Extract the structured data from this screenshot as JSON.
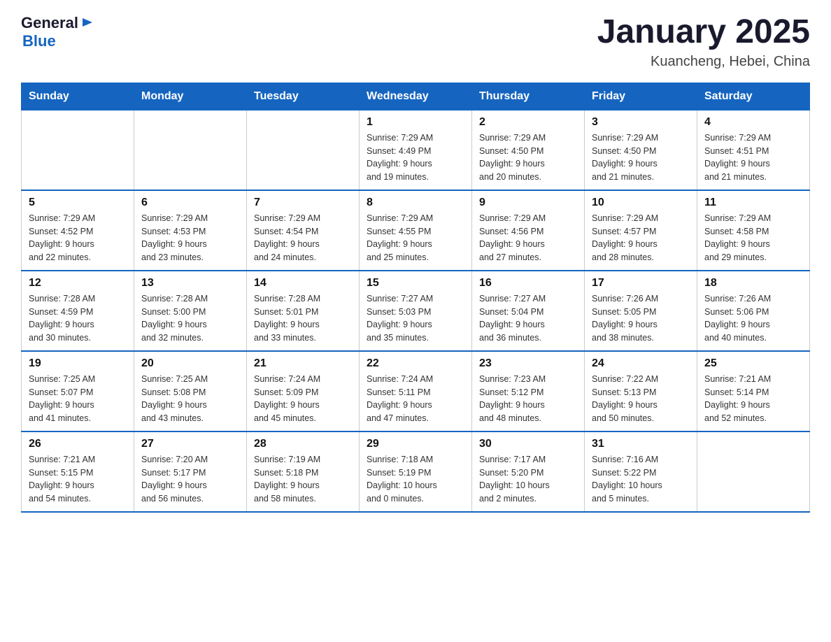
{
  "logo": {
    "general": "General",
    "blue": "Blue",
    "icon_color": "#1565c0"
  },
  "title": {
    "month_year": "January 2025",
    "location": "Kuancheng, Hebei, China"
  },
  "weekdays": [
    "Sunday",
    "Monday",
    "Tuesday",
    "Wednesday",
    "Thursday",
    "Friday",
    "Saturday"
  ],
  "weeks": [
    [
      {
        "day": "",
        "info": ""
      },
      {
        "day": "",
        "info": ""
      },
      {
        "day": "",
        "info": ""
      },
      {
        "day": "1",
        "info": "Sunrise: 7:29 AM\nSunset: 4:49 PM\nDaylight: 9 hours\nand 19 minutes."
      },
      {
        "day": "2",
        "info": "Sunrise: 7:29 AM\nSunset: 4:50 PM\nDaylight: 9 hours\nand 20 minutes."
      },
      {
        "day": "3",
        "info": "Sunrise: 7:29 AM\nSunset: 4:50 PM\nDaylight: 9 hours\nand 21 minutes."
      },
      {
        "day": "4",
        "info": "Sunrise: 7:29 AM\nSunset: 4:51 PM\nDaylight: 9 hours\nand 21 minutes."
      }
    ],
    [
      {
        "day": "5",
        "info": "Sunrise: 7:29 AM\nSunset: 4:52 PM\nDaylight: 9 hours\nand 22 minutes."
      },
      {
        "day": "6",
        "info": "Sunrise: 7:29 AM\nSunset: 4:53 PM\nDaylight: 9 hours\nand 23 minutes."
      },
      {
        "day": "7",
        "info": "Sunrise: 7:29 AM\nSunset: 4:54 PM\nDaylight: 9 hours\nand 24 minutes."
      },
      {
        "day": "8",
        "info": "Sunrise: 7:29 AM\nSunset: 4:55 PM\nDaylight: 9 hours\nand 25 minutes."
      },
      {
        "day": "9",
        "info": "Sunrise: 7:29 AM\nSunset: 4:56 PM\nDaylight: 9 hours\nand 27 minutes."
      },
      {
        "day": "10",
        "info": "Sunrise: 7:29 AM\nSunset: 4:57 PM\nDaylight: 9 hours\nand 28 minutes."
      },
      {
        "day": "11",
        "info": "Sunrise: 7:29 AM\nSunset: 4:58 PM\nDaylight: 9 hours\nand 29 minutes."
      }
    ],
    [
      {
        "day": "12",
        "info": "Sunrise: 7:28 AM\nSunset: 4:59 PM\nDaylight: 9 hours\nand 30 minutes."
      },
      {
        "day": "13",
        "info": "Sunrise: 7:28 AM\nSunset: 5:00 PM\nDaylight: 9 hours\nand 32 minutes."
      },
      {
        "day": "14",
        "info": "Sunrise: 7:28 AM\nSunset: 5:01 PM\nDaylight: 9 hours\nand 33 minutes."
      },
      {
        "day": "15",
        "info": "Sunrise: 7:27 AM\nSunset: 5:03 PM\nDaylight: 9 hours\nand 35 minutes."
      },
      {
        "day": "16",
        "info": "Sunrise: 7:27 AM\nSunset: 5:04 PM\nDaylight: 9 hours\nand 36 minutes."
      },
      {
        "day": "17",
        "info": "Sunrise: 7:26 AM\nSunset: 5:05 PM\nDaylight: 9 hours\nand 38 minutes."
      },
      {
        "day": "18",
        "info": "Sunrise: 7:26 AM\nSunset: 5:06 PM\nDaylight: 9 hours\nand 40 minutes."
      }
    ],
    [
      {
        "day": "19",
        "info": "Sunrise: 7:25 AM\nSunset: 5:07 PM\nDaylight: 9 hours\nand 41 minutes."
      },
      {
        "day": "20",
        "info": "Sunrise: 7:25 AM\nSunset: 5:08 PM\nDaylight: 9 hours\nand 43 minutes."
      },
      {
        "day": "21",
        "info": "Sunrise: 7:24 AM\nSunset: 5:09 PM\nDaylight: 9 hours\nand 45 minutes."
      },
      {
        "day": "22",
        "info": "Sunrise: 7:24 AM\nSunset: 5:11 PM\nDaylight: 9 hours\nand 47 minutes."
      },
      {
        "day": "23",
        "info": "Sunrise: 7:23 AM\nSunset: 5:12 PM\nDaylight: 9 hours\nand 48 minutes."
      },
      {
        "day": "24",
        "info": "Sunrise: 7:22 AM\nSunset: 5:13 PM\nDaylight: 9 hours\nand 50 minutes."
      },
      {
        "day": "25",
        "info": "Sunrise: 7:21 AM\nSunset: 5:14 PM\nDaylight: 9 hours\nand 52 minutes."
      }
    ],
    [
      {
        "day": "26",
        "info": "Sunrise: 7:21 AM\nSunset: 5:15 PM\nDaylight: 9 hours\nand 54 minutes."
      },
      {
        "day": "27",
        "info": "Sunrise: 7:20 AM\nSunset: 5:17 PM\nDaylight: 9 hours\nand 56 minutes."
      },
      {
        "day": "28",
        "info": "Sunrise: 7:19 AM\nSunset: 5:18 PM\nDaylight: 9 hours\nand 58 minutes."
      },
      {
        "day": "29",
        "info": "Sunrise: 7:18 AM\nSunset: 5:19 PM\nDaylight: 10 hours\nand 0 minutes."
      },
      {
        "day": "30",
        "info": "Sunrise: 7:17 AM\nSunset: 5:20 PM\nDaylight: 10 hours\nand 2 minutes."
      },
      {
        "day": "31",
        "info": "Sunrise: 7:16 AM\nSunset: 5:22 PM\nDaylight: 10 hours\nand 5 minutes."
      },
      {
        "day": "",
        "info": ""
      }
    ]
  ]
}
